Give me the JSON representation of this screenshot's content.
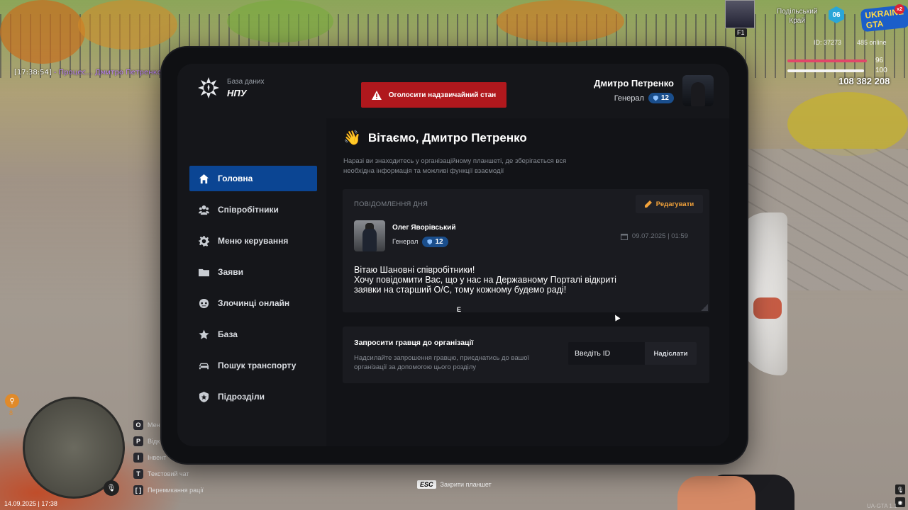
{
  "hud": {
    "chat_time": "[17:38:54]",
    "chat_text": " - Процес... Дмитро Петренко[37273]",
    "region_line1": "Подільський",
    "region_line2": "Край",
    "region_number": "06",
    "server_logo": "UKRAINE GTA",
    "server_multiplier": "x2",
    "player_id": "ID: 37273",
    "online": "485 online",
    "health": "96",
    "armor": "100",
    "money": "108 382 208",
    "hotkey_f1": "F1",
    "controls": [
      {
        "key": "O",
        "label": "Мені"
      },
      {
        "key": "P",
        "label": "Відк"
      },
      {
        "key": "I",
        "label": "Інвент"
      },
      {
        "key": "T",
        "label": "Текстовий чат"
      },
      {
        "key": "[ ]",
        "label": "Перемикання рації"
      }
    ],
    "datetime": "14.09.2025 | 17:38",
    "esc_key": "ESC",
    "esc_label": "Закрити планшет",
    "zoom_level": "8",
    "version": "UA-GTA 1.1",
    "mic_key": "Я"
  },
  "tablet": {
    "brand_sub": "База даних",
    "brand_title": "НПУ",
    "alert_button": "Оголосити надзвичайний стан",
    "user": {
      "name": "Дмитро Петренко",
      "rank": "Генерал",
      "level": "12"
    },
    "nav": [
      {
        "label": "Головна",
        "icon": "home-icon",
        "active": true
      },
      {
        "label": "Співробітники",
        "icon": "users-icon"
      },
      {
        "label": "Меню керування",
        "icon": "gear-icon"
      },
      {
        "label": "Заяви",
        "icon": "folder-icon"
      },
      {
        "label": "Злочинці онлайн",
        "icon": "criminal-mask-icon"
      },
      {
        "label": "База",
        "icon": "star-icon"
      },
      {
        "label": "Пошук транспорту",
        "icon": "car-icon"
      },
      {
        "label": "Підрозділи",
        "icon": "shield-icon"
      }
    ],
    "welcome_emoji": "👋",
    "welcome_title": "Вітаємо, Дмитро Петренко",
    "welcome_desc": "Наразі ви знаходитесь у організаційному планшеті, де зберігається вся необхідна інформація та можливі функції взаємодії",
    "motd": {
      "label": "ПОВІДОМЛЕННЯ ДНЯ",
      "edit_button": "Редагувати",
      "author_name": "Олег Яворівський",
      "author_rank": "Генерал",
      "author_level": "12",
      "date": "09.07.2025 | 01:59",
      "message": "Вітаю Шановні співробітники!\nХочу повідомити Вас, що у нас на Державному Порталі відкриті\nзаявки на старший О/С, тому кожному будемо раді!"
    },
    "cursor_hint": "E",
    "invite": {
      "title": "Запросити гравця до організації",
      "desc": "Надсилайте запрошення гравцю, приєднатись до вашої організації за допомогою цього розділу",
      "input_placeholder": "Введіть ID",
      "input_value": "",
      "send_button": "Надіслати"
    }
  },
  "colors": {
    "accent": "#0b4593",
    "danger": "#b0181d",
    "edit": "#f2a23a",
    "badge": "#1a4e8c"
  }
}
